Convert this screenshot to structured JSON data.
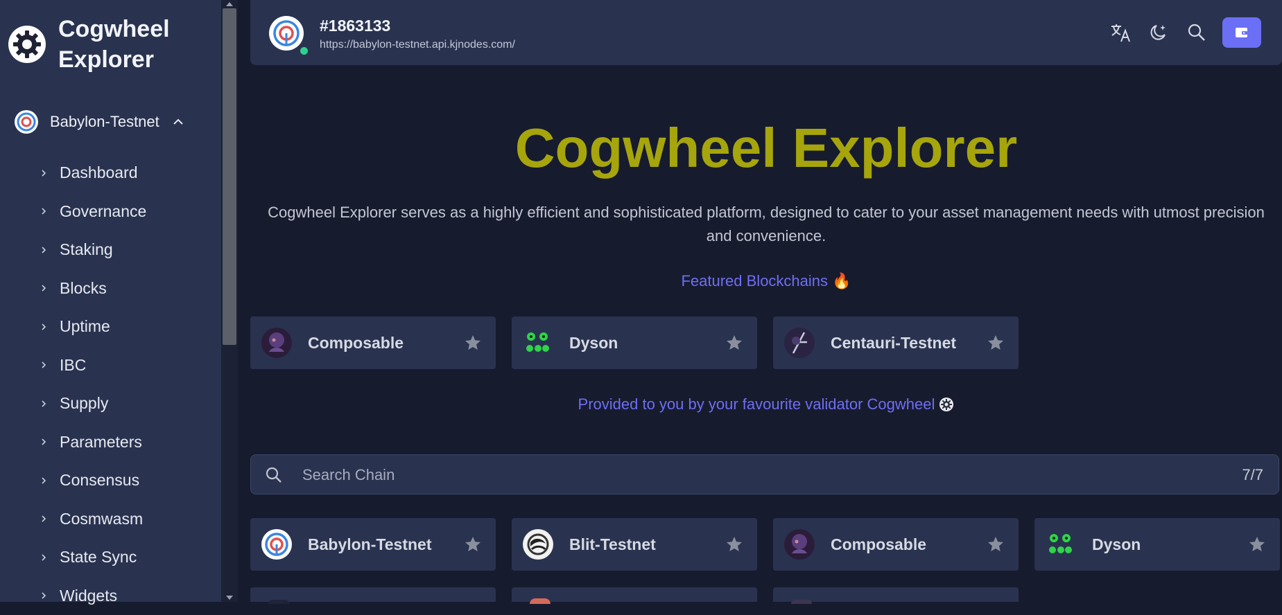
{
  "sidebar": {
    "brand": "Cogwheel Explorer",
    "chain": "Babylon-Testnet",
    "items": [
      {
        "label": "Dashboard"
      },
      {
        "label": "Governance"
      },
      {
        "label": "Staking"
      },
      {
        "label": "Blocks"
      },
      {
        "label": "Uptime"
      },
      {
        "label": "IBC"
      },
      {
        "label": "Supply"
      },
      {
        "label": "Parameters"
      },
      {
        "label": "Consensus"
      },
      {
        "label": "Cosmwasm"
      },
      {
        "label": "State Sync"
      },
      {
        "label": "Widgets"
      }
    ]
  },
  "topbar": {
    "block_height": "#1863133",
    "endpoint_url": "https://babylon-testnet.api.kjnodes.com/",
    "status": "online"
  },
  "hero": {
    "title": "Cogwheel Explorer",
    "description": "Cogwheel Explorer serves as a highly efficient and sophisticated platform, designed to cater to your asset management needs with utmost precision and convenience."
  },
  "featured": {
    "label": "Featured Blockchains 🔥",
    "chains": [
      {
        "name": "Composable"
      },
      {
        "name": "Dyson"
      },
      {
        "name": "Centauri-Testnet"
      }
    ]
  },
  "provided_text": "Provided to you by your favourite validator Cogwheel",
  "search": {
    "placeholder": "Search Chain",
    "count": "7/7"
  },
  "chains": [
    {
      "name": "Babylon-Testnet"
    },
    {
      "name": "Blit-Testnet"
    },
    {
      "name": "Composable"
    },
    {
      "name": "Dyson"
    }
  ],
  "colors": {
    "accent": "#6b6ff5",
    "title": "#a6a50c",
    "sidebar_bg": "#29334f",
    "page_bg": "#171b2e",
    "status_online": "#2ed08f"
  },
  "icons": {
    "brand": "cogwheel-icon",
    "translate": "translate-icon",
    "theme": "moon-star-icon",
    "search": "search-icon",
    "wallet": "wallet-icon",
    "favorite": "star-icon"
  }
}
